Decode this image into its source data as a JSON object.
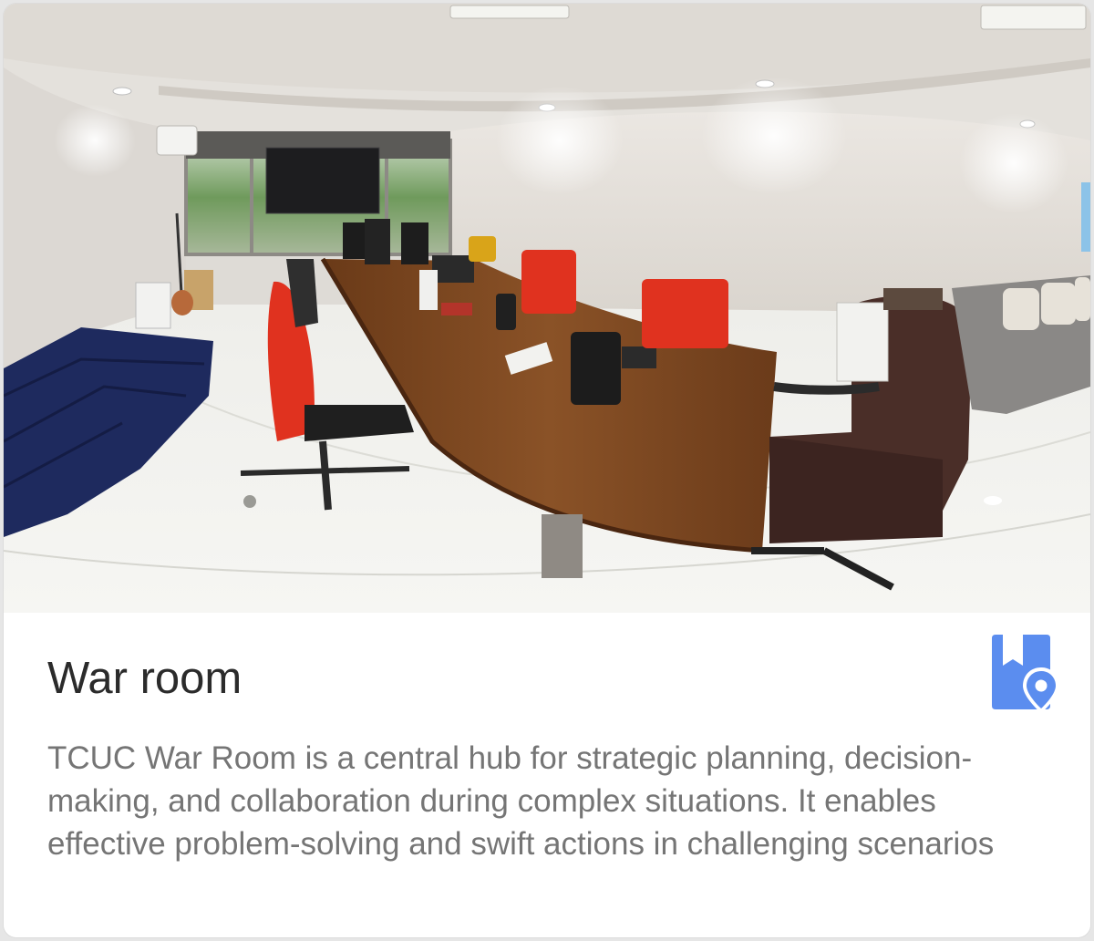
{
  "card": {
    "image_alt": "War room",
    "title": "War room",
    "description": "TCUC War Room is a central hub for strategic planning, decision-making, and collaboration during complex situations. It enables effective problem-solving and swift actions in challenging scenarios",
    "place_icon": "bookmark-location-icon"
  },
  "colors": {
    "accent": "#5b8def",
    "title": "#2b2b2b",
    "description": "#757575",
    "background": "#ffffff"
  }
}
